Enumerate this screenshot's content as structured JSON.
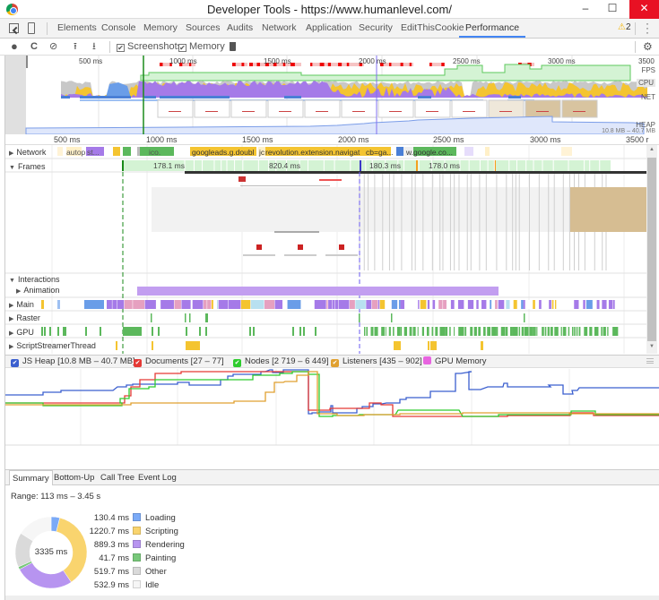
{
  "window": {
    "title": "Developer Tools - https://www.humanlevel.com/",
    "minimize_icon": "minimize-icon",
    "maximize_icon": "maximize-icon",
    "close_icon": "close-icon",
    "minimize": "–",
    "maximize": "☐",
    "close": "✕"
  },
  "tabs": [
    {
      "label": "Elements"
    },
    {
      "label": "Console"
    },
    {
      "label": "Memory"
    },
    {
      "label": "Sources"
    },
    {
      "label": "Audits"
    },
    {
      "label": "Network"
    },
    {
      "label": "Application"
    },
    {
      "label": "Security"
    },
    {
      "label": "EditThisCookie"
    },
    {
      "label": "Performance",
      "active": true
    }
  ],
  "warnings": {
    "icon": "⚠",
    "count": "2"
  },
  "toolbar": {
    "record": "●",
    "reload": "C",
    "clear": "⊘",
    "upload": "⭱",
    "download": "⭳",
    "screenshots_label": "Screenshots",
    "screenshots_checked": true,
    "memory_label": "Memory",
    "memory_checked": true,
    "trash": "🗑",
    "settings": "⚙",
    "check": "✔"
  },
  "overview": {
    "ticks": [
      "500 ms",
      "1000 ms",
      "1500 ms",
      "2000 ms",
      "2500 ms",
      "3000 ms",
      "3500"
    ],
    "lanes": {
      "fps": "FPS",
      "cpu": "CPU",
      "net": "NET",
      "heap": "HEAP"
    },
    "heap_range": "10.8 MB – 40.7 MB"
  },
  "ruler": {
    "ticks": [
      "500 ms",
      "1000 ms",
      "1500 ms",
      "2000 ms",
      "2500 ms",
      "3000 ms",
      "3500 r"
    ]
  },
  "network_items": [
    "autop",
    "st...",
    "ico.",
    "googleads.g.doubl",
    "jc",
    "revolution.extension.navigat",
    "cb=ga...",
    "w.google.co..."
  ],
  "frames": {
    "durations": [
      "178.1 ms",
      "820.4 ms",
      "180.3 ms",
      "178.0 ms"
    ]
  },
  "tracks": {
    "network": "Network",
    "frames": "Frames",
    "interactions": "Interactions",
    "animation": "Animation",
    "main": "Main",
    "raster": "Raster",
    "gpu": "GPU",
    "script_streamer": "ScriptStreamerThread"
  },
  "memory_legend": [
    {
      "label": "JS Heap [10.8 MB – 40.7 MB]",
      "color": "#3b5fcf",
      "checked": true
    },
    {
      "label": "Documents [27 – 77]",
      "color": "#e53935",
      "checked": true
    },
    {
      "label": "Nodes [2 719 – 6 449]",
      "color": "#2ecc2e",
      "checked": true
    },
    {
      "label": "Listeners [435 – 902]",
      "color": "#e0a030",
      "checked": true
    },
    {
      "label": "GPU Memory",
      "color": "#e864e0",
      "checked": false
    }
  ],
  "bottom_tabs": [
    {
      "label": "Summary",
      "active": true
    },
    {
      "label": "Bottom-Up"
    },
    {
      "label": "Call Tree"
    },
    {
      "label": "Event Log"
    }
  ],
  "summary": {
    "range": "Range: 113 ms – 3.45 s",
    "total": "3335 ms",
    "rows": [
      {
        "value": "130.4 ms",
        "label": "Loading",
        "color": "#7baaf7",
        "ms": 130.4
      },
      {
        "value": "1220.7 ms",
        "label": "Scripting",
        "color": "#f9d46e",
        "ms": 1220.7
      },
      {
        "value": "889.3 ms",
        "label": "Rendering",
        "color": "#b794f0",
        "ms": 889.3
      },
      {
        "value": "41.7 ms",
        "label": "Painting",
        "color": "#78c87a",
        "ms": 41.7
      },
      {
        "value": "519.7 ms",
        "label": "Other",
        "color": "#dadada",
        "ms": 519.7
      },
      {
        "value": "532.9 ms",
        "label": "Idle",
        "color": "#f6f6f6",
        "ms": 532.9
      }
    ]
  },
  "colors": {
    "accent": "#4285f4",
    "loading": "#6a9de8",
    "scripting": "#f4c430",
    "rendering": "#a57ae8",
    "painting": "#5cb85c",
    "other": "#c8c8c8",
    "fps": "#5ec85e"
  }
}
